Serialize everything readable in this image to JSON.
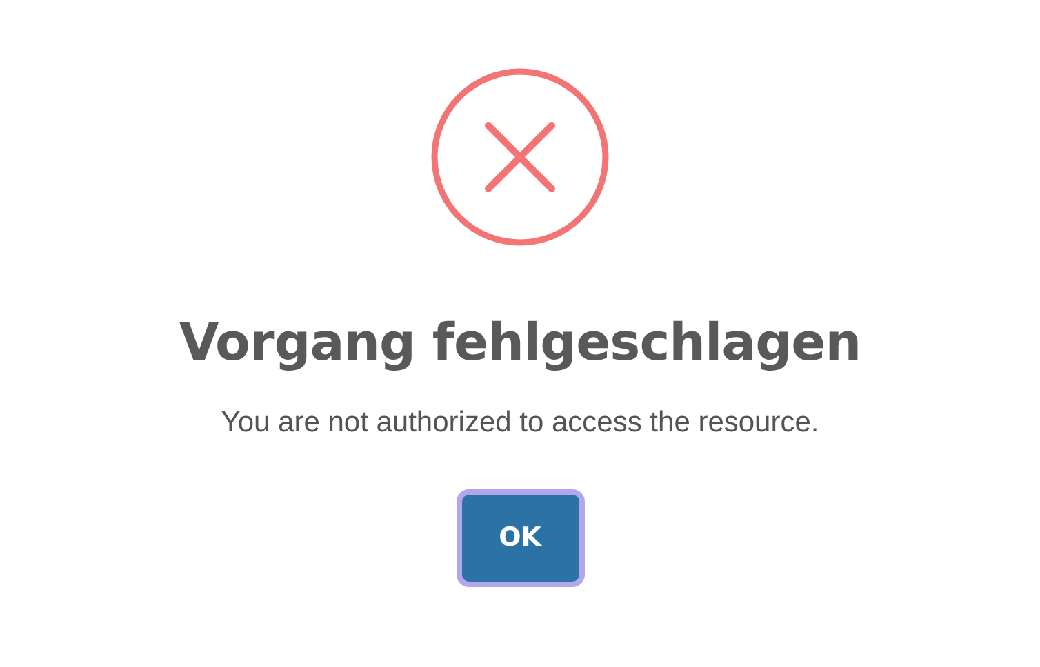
{
  "dialog": {
    "kind": "error",
    "title": "Vorgang fehlgeschlagen",
    "message": "You are not authorized to access the resource.",
    "confirm_button": {
      "label": "OK",
      "focused": true
    }
  }
}
